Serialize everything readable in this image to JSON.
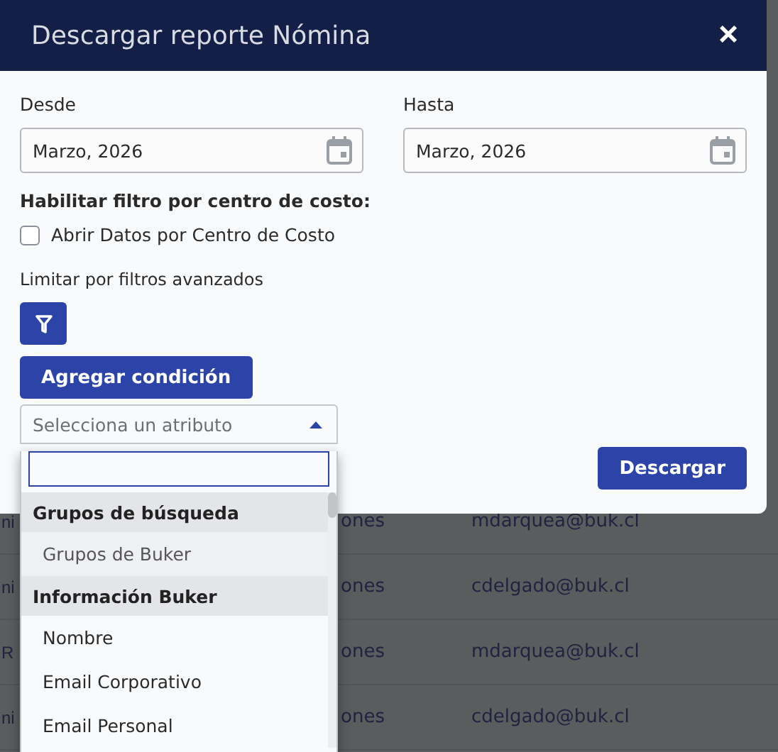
{
  "background_table": {
    "rows": [
      {
        "column_1": "ni",
        "column_2": "ones",
        "column_3": "mdarquea@buk.cl"
      },
      {
        "column_1": "ni",
        "column_2": "ones",
        "column_3": "cdelgado@buk.cl"
      },
      {
        "column_1": "R",
        "column_2": "ones",
        "column_3": "mdarquea@buk.cl"
      },
      {
        "column_1": "ni",
        "column_2": "ones",
        "column_3": "cdelgado@buk.cl"
      }
    ]
  },
  "dialog": {
    "title": "Descargar reporte Nómina",
    "close": "×",
    "from": {
      "label": "Desde",
      "value": "Marzo, 2026"
    },
    "to": {
      "label": "Hasta",
      "value": "Marzo, 2026"
    },
    "cost_center_heading": "Habilitar filtro por centro de costo:",
    "cost_center_checkbox": {
      "label": "Abrir Datos por Centro de Costo",
      "checked": false
    },
    "advanced_filters_label": "Limitar por filtros avanzados",
    "add_condition_button": "Agregar condición",
    "download_button": "Descargar"
  },
  "attribute_select": {
    "placeholder": "Selecciona un atributo",
    "expanded": true,
    "options": [
      {
        "kind": "group",
        "label": "Grupos de búsqueda"
      },
      {
        "kind": "option",
        "label": "Grupos de Buker",
        "selected": true
      },
      {
        "kind": "group",
        "label": "Información Buker"
      },
      {
        "kind": "option",
        "label": "Nombre",
        "selected": false
      },
      {
        "kind": "option",
        "label": "Email Corporativo",
        "selected": false
      },
      {
        "kind": "option",
        "label": "Email Personal",
        "selected": false
      }
    ]
  }
}
